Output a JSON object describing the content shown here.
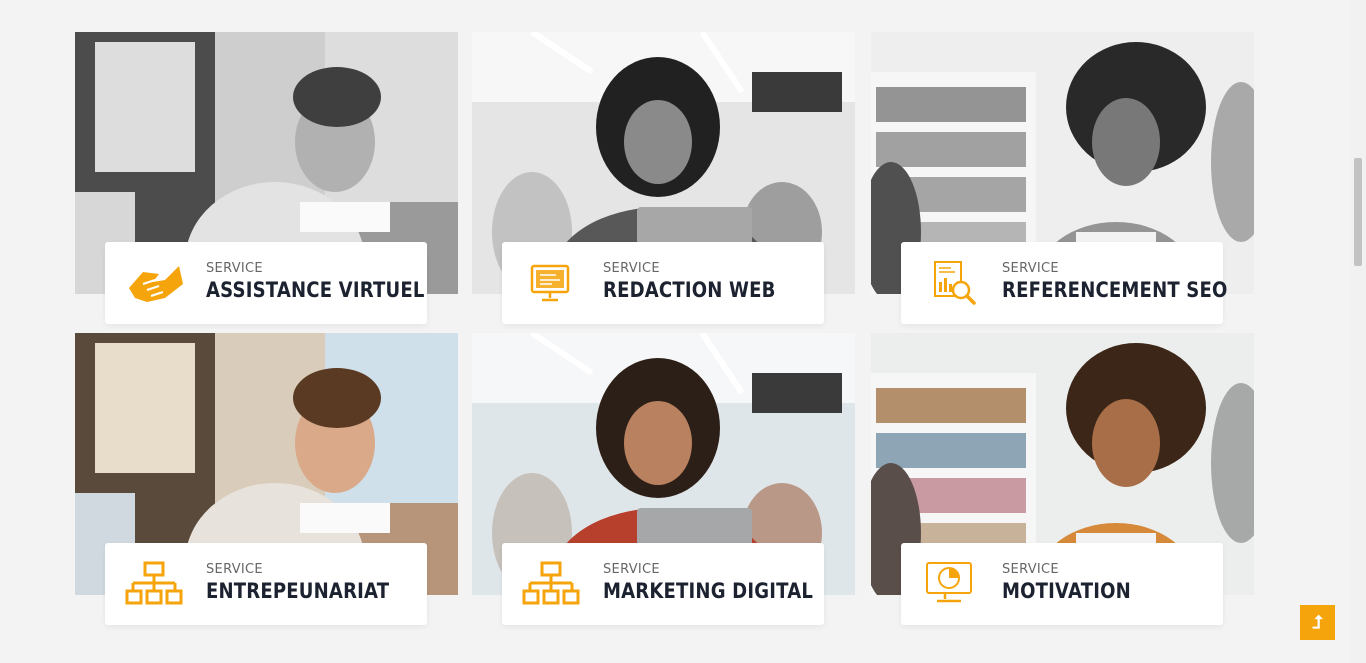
{
  "brand": {
    "accent": "#f5a50b",
    "title_color": "#1c2230"
  },
  "services": [
    {
      "kicker": "SERVICE",
      "title": "ASSISTANCE VIRTUEL",
      "icon": "handshake-icon",
      "photo": "man-with-laptop-photo",
      "grayscale": true
    },
    {
      "kicker": "SERVICE",
      "title": "REDACTION WEB",
      "icon": "computer-monitor-icon",
      "photo": "woman-with-tablet-photo",
      "grayscale": true
    },
    {
      "kicker": "SERVICE",
      "title": "REFERENCEMENT SEO",
      "icon": "seo-report-magnifier-icon",
      "photo": "smiling-woman-office-photo",
      "grayscale": true
    },
    {
      "kicker": "SERVICE",
      "title": "ENTREPEUNARIAT",
      "icon": "network-hierarchy-icon",
      "photo": "man-with-laptop-photo",
      "grayscale": false
    },
    {
      "kicker": "SERVICE",
      "title": "MARKETING DIGITAL",
      "icon": "network-hierarchy-icon",
      "photo": "woman-with-tablet-photo",
      "grayscale": false
    },
    {
      "kicker": "SERVICE",
      "title": "MOTIVATION",
      "icon": "monitor-chart-icon",
      "photo": "smiling-woman-office-photo",
      "grayscale": false
    }
  ],
  "back_to_top": {
    "glyph": "⮥",
    "icon": "arrow-up-icon"
  }
}
